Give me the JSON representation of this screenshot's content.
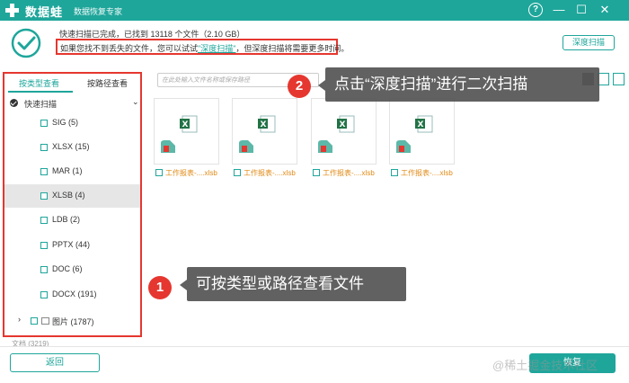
{
  "app": {
    "name": "数据蛙",
    "subtitle": "数据恢复专家"
  },
  "window": {
    "help": "?",
    "minimize": "—",
    "maximize": "☐",
    "close": "✕"
  },
  "header": {
    "status": "快速扫描已完成，已找到 13118 个文件（2.10 GB）",
    "hint_prefix": "如果您找不到丢失的文件，您可以试试",
    "hint_link": "\"深度扫描\"",
    "hint_suffix": "，但深度扫描将需要更多时间。",
    "deep_scan_button": "深度扫描"
  },
  "sidebar": {
    "tab_type": "按类型查看",
    "tab_path": "按路径查看",
    "root_label": "快速扫描",
    "items": [
      {
        "label": "SIG (5)"
      },
      {
        "label": "XLSX (15)"
      },
      {
        "label": "MAR (1)"
      },
      {
        "label": "XLSB (4)"
      },
      {
        "label": "LDB (2)"
      },
      {
        "label": "PPTX (44)"
      },
      {
        "label": "DOC (6)"
      },
      {
        "label": "DOCX (191)"
      }
    ],
    "pictures": "图片 (1787)",
    "partial": "文档 (3219)"
  },
  "toolbar": {
    "search_placeholder": "在此处输入文件名称或保存路径"
  },
  "files": [
    {
      "name": "工作报表-....xlsb"
    },
    {
      "name": "工作报表-....xlsb"
    },
    {
      "name": "工作报表-....xlsb"
    },
    {
      "name": "工作报表-....xlsb"
    }
  ],
  "footer": {
    "back": "返回",
    "recover": "恢复",
    "watermark": "@稀土掘金技术社区"
  },
  "annotations": {
    "badge_1": "1",
    "text_1": "可按类型或路径查看文件",
    "badge_2": "2",
    "text_2": "点击“深度扫描”进行二次扫描"
  },
  "colors": {
    "brand": "#1fa69b",
    "highlight": "#e5372f",
    "file_name": "#e08a16"
  }
}
